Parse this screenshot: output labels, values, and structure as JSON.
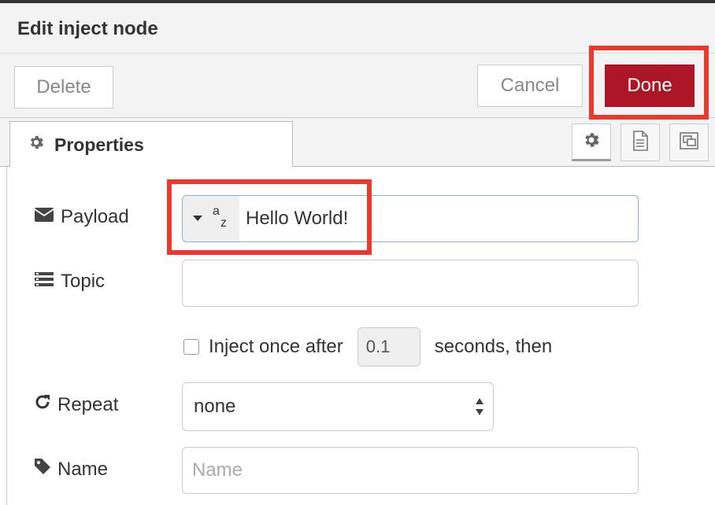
{
  "dialog": {
    "title": "Edit inject node"
  },
  "toolbar": {
    "delete_label": "Delete",
    "cancel_label": "Cancel",
    "done_label": "Done"
  },
  "tabs": {
    "properties_label": "Properties",
    "icons": [
      "gear-icon",
      "document-icon",
      "frame-icon"
    ]
  },
  "form": {
    "payload": {
      "label": "Payload",
      "type_icon": "string-type-icon",
      "value": "Hello World!"
    },
    "topic": {
      "label": "Topic",
      "value": ""
    },
    "inject_once": {
      "checked": false,
      "label": "Inject once after",
      "delay": "0.1",
      "suffix": "seconds, then"
    },
    "repeat": {
      "label": "Repeat",
      "value": "none"
    },
    "name": {
      "label": "Name",
      "placeholder": "Name",
      "value": ""
    }
  },
  "colors": {
    "done": "#ad1625",
    "highlight": "#e63b2e",
    "focus": "#85b1e0"
  }
}
